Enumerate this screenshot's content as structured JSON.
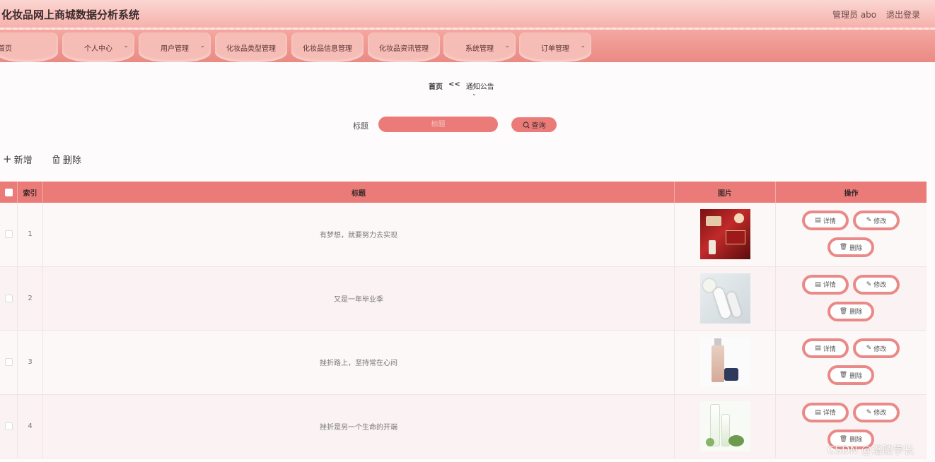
{
  "header": {
    "title": "化妆品网上商城数据分析系统",
    "admin": "管理员 abo",
    "logout": "退出登录"
  },
  "nav": {
    "items": [
      {
        "label": "首页",
        "has_dropdown": false
      },
      {
        "label": "个人中心",
        "has_dropdown": true
      },
      {
        "label": "用户管理",
        "has_dropdown": true
      },
      {
        "label": "化妆品类型管理",
        "has_dropdown": false
      },
      {
        "label": "化妆品信息管理",
        "has_dropdown": false
      },
      {
        "label": "化妆品资讯管理",
        "has_dropdown": false
      },
      {
        "label": "系统管理",
        "has_dropdown": true
      },
      {
        "label": "订单管理",
        "has_dropdown": true
      }
    ]
  },
  "breadcrumb": {
    "home": "首页",
    "separator": "<<",
    "current": "通知公告"
  },
  "search": {
    "label": "标题",
    "placeholder": "标题",
    "button": "查询"
  },
  "actions": {
    "add": "新增",
    "delete": "删除"
  },
  "table": {
    "columns": {
      "index": "索引",
      "title": "标题",
      "image": "图片",
      "operation": "操作"
    },
    "rows": [
      {
        "index": "1",
        "title": "有梦想，就要努力去实现",
        "image": "red-gift-box-cosmetics"
      },
      {
        "index": "2",
        "title": "又是一年毕业季",
        "image": "white-skincare-bottles"
      },
      {
        "index": "3",
        "title": "挫折路上，坚持常在心间",
        "image": "foundation-bottle-and-cream-jar"
      },
      {
        "index": "4",
        "title": "挫折是另一个生命的开端",
        "image": "green-skincare-set"
      }
    ],
    "row_buttons": {
      "detail": "详情",
      "edit": "修改",
      "delete": "删除"
    }
  },
  "watermark": "CSDN @涪陵学长",
  "colors": {
    "accent": "#ea7b78",
    "nav_bg": "#f4a7a0",
    "header_bg": "#f6b1ab"
  }
}
